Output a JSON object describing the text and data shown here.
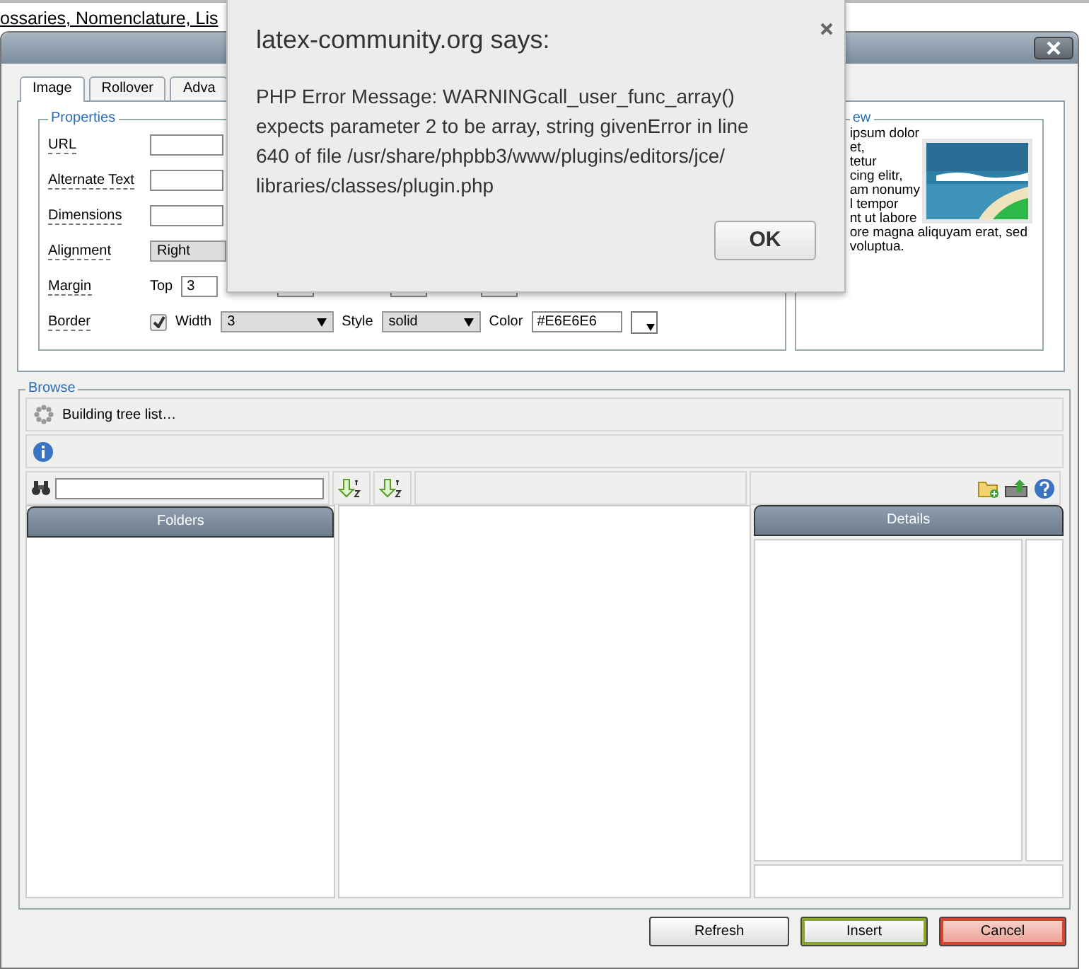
{
  "page_behind": {
    "link_text": "ossaries, Nomenclature, Lis"
  },
  "alert": {
    "title": "latex-community.org says:",
    "message": "PHP Error Message: WARNINGcall_user_func_array() expects parameter 2 to be array, string givenError in line 640 of file /usr/share/phpbb3/www/plugins/editors/jce/ libraries/classes/plugin.php",
    "ok_button": "OK"
  },
  "dialog": {
    "tabs": [
      {
        "label": "Image",
        "selected": true
      },
      {
        "label": "Rollover",
        "selected": false
      },
      {
        "label": "Adva",
        "selected": false
      }
    ],
    "properties": {
      "legend": "Properties",
      "fields": [
        {
          "kind": "text",
          "label": "URL"
        },
        {
          "kind": "text",
          "label": "Alternate Text"
        },
        {
          "kind": "text",
          "label": "Dimensions"
        },
        {
          "kind": "select",
          "label": "Alignment",
          "value": "Right"
        },
        {
          "kind": "margin",
          "label": "Margin",
          "top_label": "Top",
          "top_value": "3"
        },
        {
          "kind": "border",
          "label": "Border",
          "checked": true,
          "width_label": "Width",
          "width_value": "3",
          "style_label": "Style",
          "style_value": "solid",
          "color_label": "Color",
          "color_value": "#E6E6E6"
        }
      ]
    },
    "preview": {
      "legend": "ew",
      "lines": [
        "ipsum dolor",
        "et,",
        "tetur",
        "cing elitr,",
        "am nonumy",
        "l tempor",
        "nt ut labore",
        "ore magna aliquyam erat, sed",
        "voluptua."
      ]
    },
    "browse": {
      "legend": "Browse",
      "status": "Building tree list…",
      "folders_header": "Folders",
      "details_header": "Details"
    },
    "buttons": [
      {
        "kind": "refresh",
        "label": "Refresh"
      },
      {
        "kind": "insert",
        "label": "Insert"
      },
      {
        "kind": "cancel",
        "label": "Cancel"
      }
    ]
  }
}
